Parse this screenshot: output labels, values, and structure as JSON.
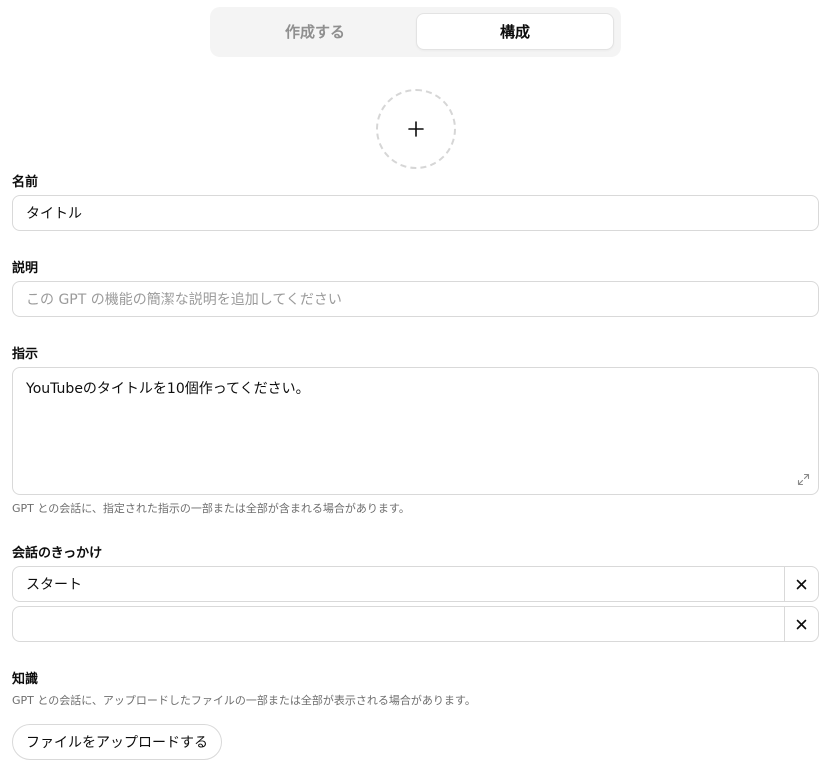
{
  "tabs": {
    "create": "作成する",
    "configure": "構成",
    "active": "configure"
  },
  "name": {
    "label": "名前",
    "value": "タイトル"
  },
  "description": {
    "label": "説明",
    "placeholder": "この GPT の機能の簡潔な説明を追加してください"
  },
  "instructions": {
    "label": "指示",
    "value": "YouTubeのタイトルを10個作ってください。",
    "hint": "GPT との会話に、指定された指示の一部または全部が含まれる場合があります。"
  },
  "conversation_starters": {
    "label": "会話のきっかけ",
    "items": [
      {
        "value": "スタート"
      },
      {
        "value": ""
      }
    ]
  },
  "knowledge": {
    "label": "知識",
    "hint": "GPT との会話に、アップロードしたファイルの一部または全部が表示される場合があります。",
    "upload_label": "ファイルをアップロードする"
  },
  "icons": {
    "avatar": "plus-icon",
    "expand": "expand-icon",
    "remove": "close-icon"
  }
}
